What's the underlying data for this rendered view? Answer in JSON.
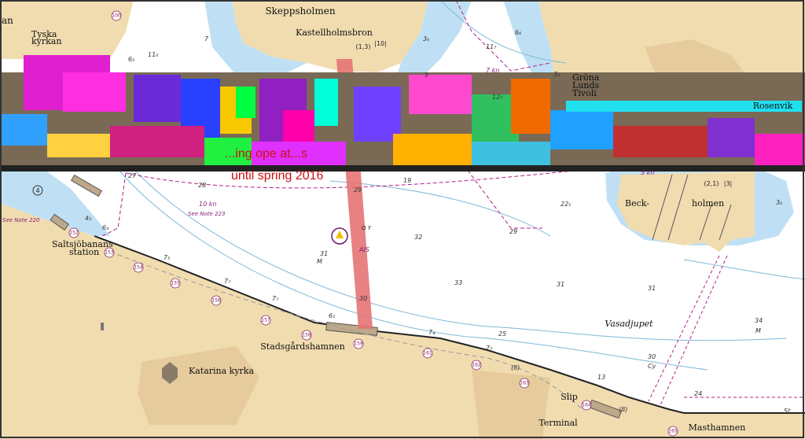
{
  "colors": {
    "land": "#f1dcb0",
    "land_dark": "#e6cc9c",
    "shallow": "#bfe0f4",
    "water": "#ffffff",
    "limit_line": "#b21f86",
    "closure_band": "#e57373",
    "notice_text": "#cc1010"
  },
  "places": {
    "skeppsholmen": "Skeppsholmen",
    "kastellholmsbron": "Kastellholmsbron",
    "bridge_clearance": "(1,3)",
    "bridge_clearance_2": "|10|",
    "tyska_kyrkan_1": "Tyska",
    "tyska_kyrkan_2": "kyrkan",
    "gamla_partial": "an",
    "grona_1": "Gröna",
    "grona_2": "Lunds",
    "grona_3": "Tivoli",
    "beck_1": "Beck-",
    "beck_2": "holmen",
    "beck_clearance": "(2,1)",
    "beck_clearance_2": "|3|",
    "saltsjo_1": "Saltsjöbanans",
    "saltsjo_2": "station",
    "stadsgardshamnen": "Stadsgårdshamnen",
    "katarina": "Katarina kyrka",
    "vasadjupet": "Vasadjupet",
    "slip": "Slip",
    "terminal": "Terminal",
    "masthamnen": "Masthamnen",
    "rosenvik": "Rosenvik"
  },
  "notes": {
    "speed_7": "7 kn",
    "speed_10": "10 kn",
    "speed_5": "5 kn",
    "see_223": "See Note 223",
    "see_220": "See Note 220",
    "light_char": "Q Y",
    "ais": "AIS",
    "notice_line1": "...ing ope at...s",
    "notice_line2": "until spring 2016",
    "circle_4": "4"
  },
  "depths": [
    {
      "v": "7"
    },
    {
      "v": "6₅"
    },
    {
      "v": "11₆"
    },
    {
      "v": "3₆"
    },
    {
      "v": "6₆"
    },
    {
      "v": "11₇"
    },
    {
      "v": "3₆"
    },
    {
      "v": "5"
    },
    {
      "v": "12₇"
    },
    {
      "v": "28"
    },
    {
      "v": "29"
    },
    {
      "v": "19"
    },
    {
      "v": "22₅"
    },
    {
      "v": "29"
    },
    {
      "v": "32"
    },
    {
      "v": "31"
    },
    {
      "v": "M"
    },
    {
      "v": "33"
    },
    {
      "v": "31"
    },
    {
      "v": "31"
    },
    {
      "v": "30"
    },
    {
      "v": "25"
    },
    {
      "v": "30"
    },
    {
      "v": "Cy"
    },
    {
      "v": "34"
    },
    {
      "v": "M"
    },
    {
      "v": "13"
    },
    {
      "v": "24"
    },
    {
      "v": "St"
    },
    {
      "v": "(8)"
    },
    {
      "v": "(8)"
    },
    {
      "v": "7₄"
    },
    {
      "v": "7₇"
    },
    {
      "v": "7₅"
    },
    {
      "v": "7₇"
    },
    {
      "v": "7₇"
    },
    {
      "v": "6₁"
    },
    {
      "v": "4₅"
    },
    {
      "v": "6₃"
    },
    {
      "v": "27"
    },
    {
      "v": "3₆"
    }
  ],
  "berths": [
    "152",
    "153",
    "154",
    "155",
    "156",
    "157",
    "158",
    "159",
    "161",
    "162",
    "163",
    "164",
    "165",
    "100"
  ]
}
